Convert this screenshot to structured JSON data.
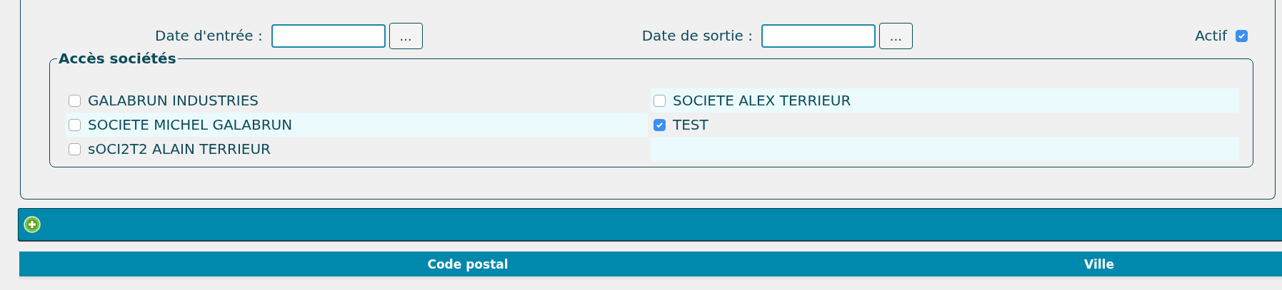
{
  "dates": [
    {
      "label": "Date d'entrée :",
      "button": "..."
    },
    {
      "label": "Date de sortie :",
      "button": "..."
    }
  ],
  "active": {
    "label": "Actif",
    "checked": true
  },
  "companies": {
    "legend": "Accès sociétés",
    "items": [
      {
        "name": "GALABRUN INDUSTRIES",
        "checked": false
      },
      {
        "name": "SOCIETE ALEX TERRIEUR",
        "checked": false
      },
      {
        "name": "SOCIETE MICHEL GALABRUN",
        "checked": false
      },
      {
        "name": "TEST",
        "checked": true
      },
      {
        "name": "sOCI2T2 ALAIN TERRIEUR",
        "checked": false
      }
    ]
  },
  "table": {
    "columns": [
      "Code postal",
      "Ville"
    ]
  }
}
